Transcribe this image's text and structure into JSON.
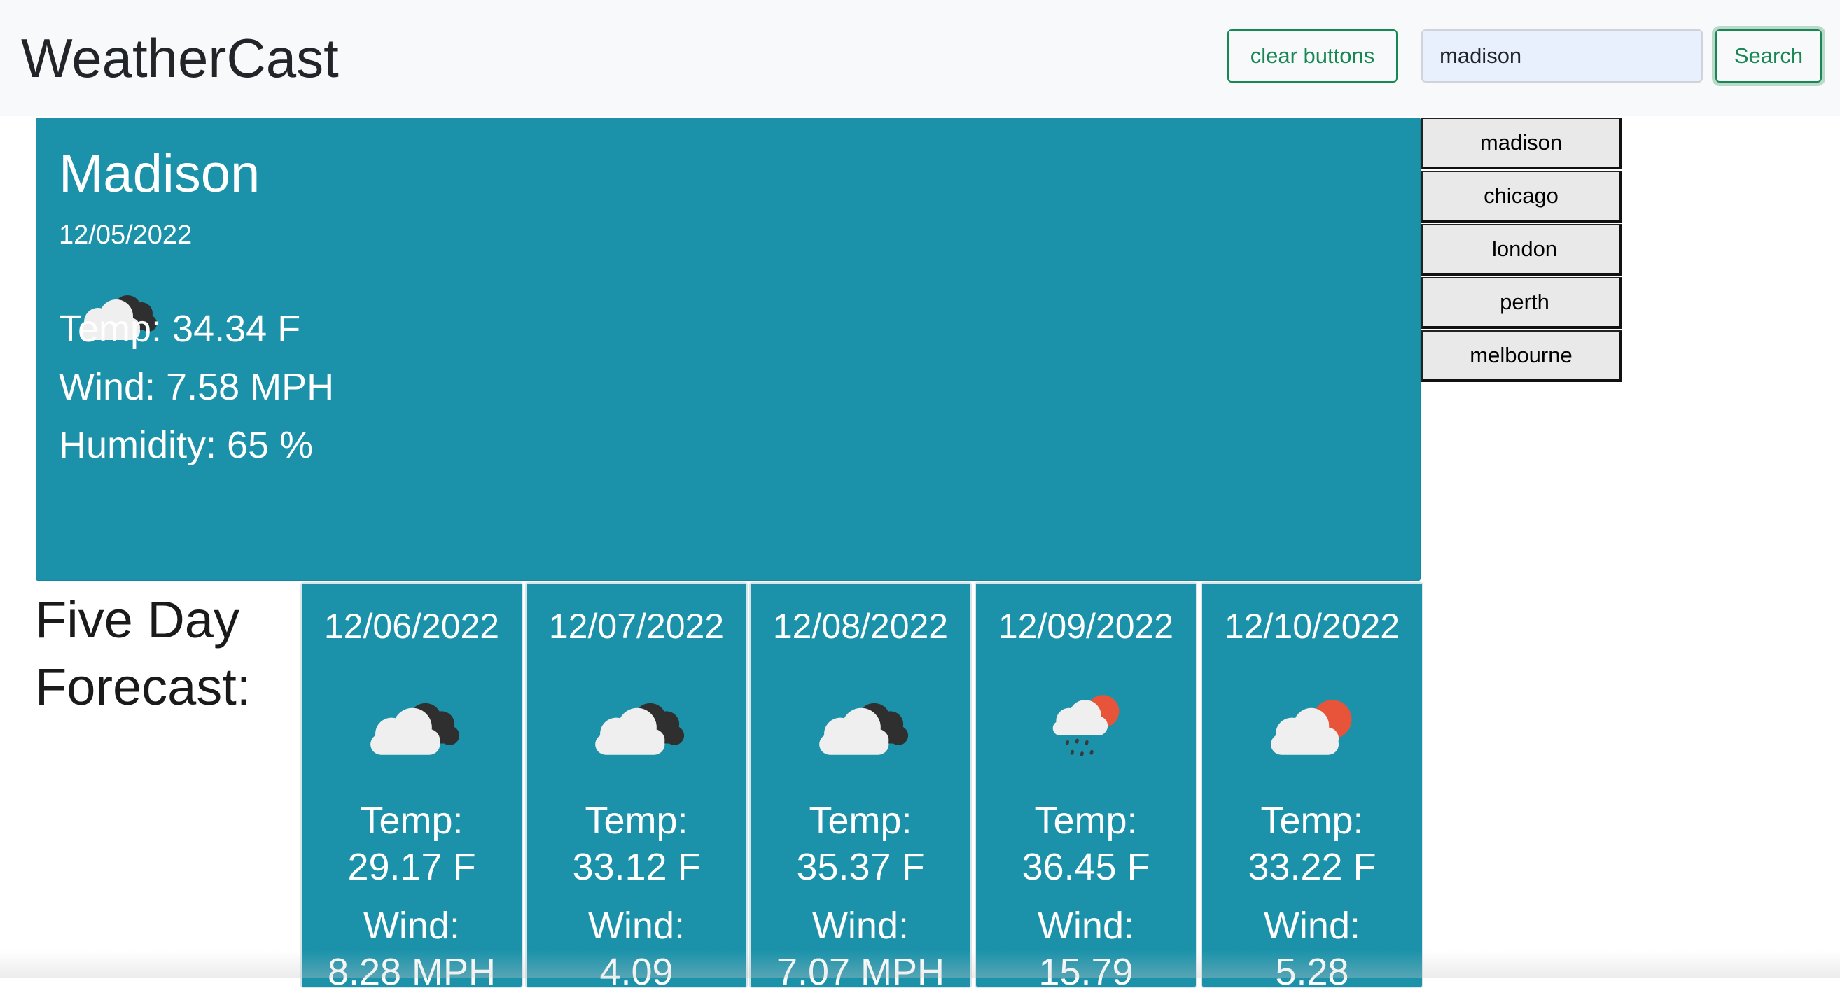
{
  "navbar": {
    "brand": "WeatherCast",
    "clear_label": "clear buttons",
    "search_value": "madison",
    "search_label": "Search"
  },
  "history": [
    "madison",
    "chicago",
    "london",
    "perth",
    "melbourne"
  ],
  "today": {
    "city": "Madison",
    "date": "12/05/2022",
    "icon": "broken-clouds-icon",
    "temp": "Temp: 34.34 F",
    "wind": "Wind: 7.58 MPH",
    "humidity": "Humidity: 65 %"
  },
  "forecast": {
    "label_line1": "Five Day",
    "label_line2": "Forecast:",
    "days": [
      {
        "date": "12/06/2022",
        "icon": "broken-clouds-icon",
        "temp_label": "Temp:",
        "temp": "29.17 F",
        "wind_label": "Wind:",
        "wind": "8.28 MPH"
      },
      {
        "date": "12/07/2022",
        "icon": "broken-clouds-icon",
        "temp_label": "Temp:",
        "temp": "33.12 F",
        "wind_label": "Wind:",
        "wind": "4.09"
      },
      {
        "date": "12/08/2022",
        "icon": "broken-clouds-icon",
        "temp_label": "Temp:",
        "temp": "35.37 F",
        "wind_label": "Wind:",
        "wind": "7.07 MPH"
      },
      {
        "date": "12/09/2022",
        "icon": "rain-sun-icon",
        "temp_label": "Temp:",
        "temp": "36.45 F",
        "wind_label": "Wind:",
        "wind": "15.79"
      },
      {
        "date": "12/10/2022",
        "icon": "partly-cloudy-icon",
        "temp_label": "Temp:",
        "temp": "33.22 F",
        "wind_label": "Wind:",
        "wind": "5.28"
      }
    ]
  },
  "colors": {
    "card_bg": "#1b92aa",
    "accent_green": "#198754",
    "input_bg": "#e8f0fe",
    "sun": "#e8543a"
  }
}
